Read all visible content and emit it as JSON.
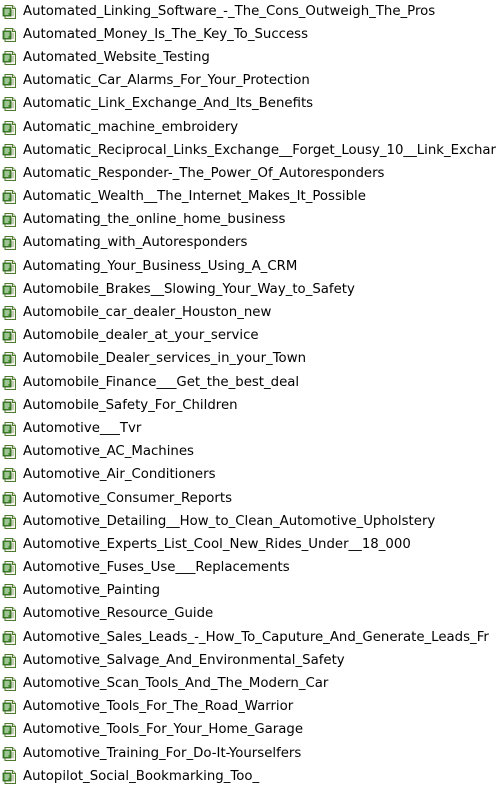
{
  "file_list": {
    "icon": "text-document-icon",
    "items": [
      "Automated_Linking_Software_-_The_Cons_Outweigh_The_Pros",
      "Automated_Money_Is_The_Key_To_Success",
      "Automated_Website_Testing",
      "Automatic_Car_Alarms_For_Your_Protection",
      "Automatic_Link_Exchange_And_Its_Benefits",
      "Automatic_machine_embroidery",
      "Automatic_Reciprocal_Links_Exchange__Forget_Lousy_10__Link_Exchar",
      "Automatic_Responder-_The_Power_Of_Autoresponders",
      "Automatic_Wealth__The_Internet_Makes_It_Possible",
      "Automating_the_online_home_business",
      "Automating_with_Autoresponders",
      "Automating_Your_Business_Using_A_CRM",
      "Automobile_Brakes__Slowing_Your_Way_to_Safety",
      "Automobile_car_dealer_Houston_new",
      "Automobile_dealer_at_your_service",
      "Automobile_Dealer_services_in_your_Town",
      "Automobile_Finance___Get_the_best_deal",
      "Automobile_Safety_For_Children",
      "Automotive___Tvr",
      "Automotive_AC_Machines",
      "Automotive_Air_Conditioners",
      "Automotive_Consumer_Reports",
      "Automotive_Detailing__How_to_Clean_Automotive_Upholstery",
      "Automotive_Experts_List_Cool_New_Rides_Under__18_000",
      "Automotive_Fuses_Use___Replacements",
      "Automotive_Painting",
      "Automotive_Resource_Guide",
      "Automotive_Sales_Leads_-_How_To_Caputure_And_Generate_Leads_Fr",
      "Automotive_Salvage_And_Environmental_Safety",
      "Automotive_Scan_Tools_And_The_Modern_Car",
      "Automotive_Tools_For_The_Road_Warrior",
      "Automotive_Tools_For_Your_Home_Garage",
      "Automotive_Training_For_Do-It-Yourselfers",
      "Autopilot_Social_Bookmarking_Too_"
    ]
  }
}
